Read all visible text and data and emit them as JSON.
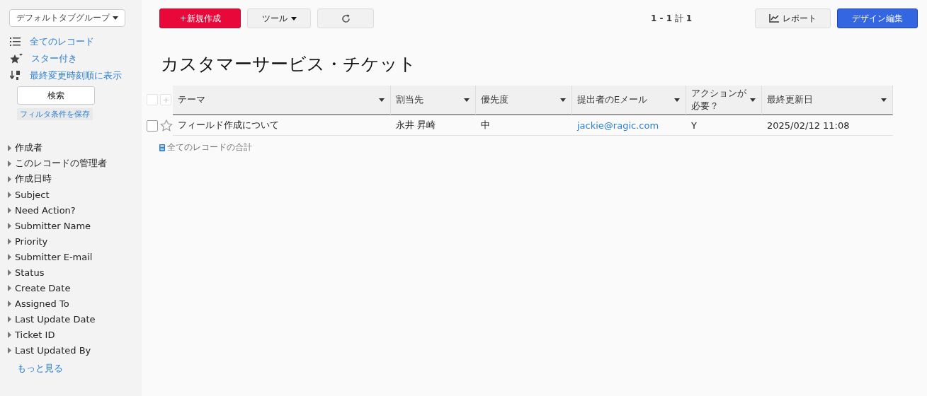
{
  "sidebar": {
    "tab_group": "デフォルトタブグループ",
    "views": [
      {
        "kind": "list",
        "label": "全てのレコード"
      },
      {
        "kind": "starred",
        "label": "スター付き"
      },
      {
        "kind": "sort",
        "label": "最終変更時刻順に表示"
      }
    ],
    "search_button": "検索",
    "save_filter": "フィルタ条件を保存",
    "fields": [
      "作成者",
      "このレコードの管理者",
      "作成日時",
      "Subject",
      "Need Action?",
      "Submitter Name",
      "Priority",
      "Submitter E-mail",
      "Status",
      "Create Date",
      "Assigned To",
      "Last Update Date",
      "Ticket ID",
      "Last Updated By"
    ],
    "more_link": "もっと見る"
  },
  "toolbar": {
    "new_button": "+新規作成",
    "tools_button": "ツール",
    "pager": "**1 - 1** 計 **1**",
    "report_button": "レポート",
    "design_button": "デザイン編集"
  },
  "title": "カスタマーサービス・チケット",
  "table": {
    "all_selected": false,
    "columns": [
      {
        "label": "テーマ",
        "kind": "text"
      },
      {
        "label": "割当先",
        "kind": "text"
      },
      {
        "label": "優先度",
        "kind": "text"
      },
      {
        "label": "提出者のEメール",
        "kind": "link"
      },
      {
        "label": "アクションが必要？",
        "kind": "text"
      },
      {
        "label": "最終更新日",
        "kind": "text"
      }
    ],
    "rows": [
      {
        "selected": false,
        "starred": false,
        "cells": [
          "フィールド作成について",
          "永井 昇崎",
          "中",
          "jackie@ragic.com",
          "Y",
          "2025/02/12 11:08"
        ]
      }
    ],
    "footer": "全てのレコードの合計"
  }
}
